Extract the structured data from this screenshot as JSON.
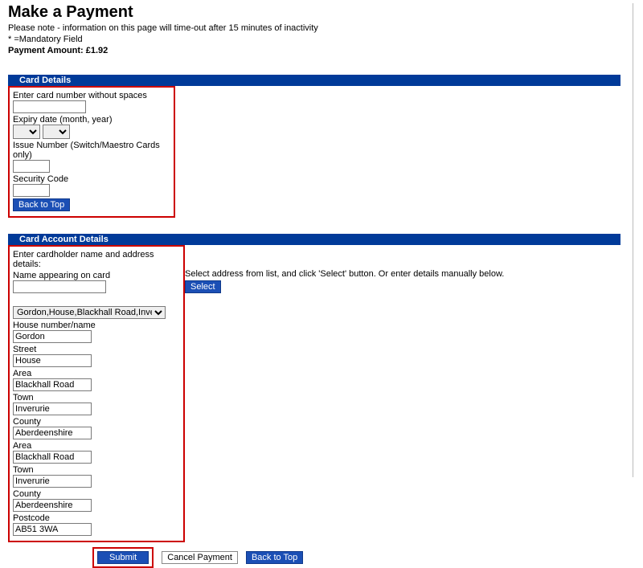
{
  "header": {
    "title": "Make a Payment",
    "note": "Please note - information on this page will time-out after 15 minutes of inactivity",
    "mandatory_hint": "* =Mandatory Field",
    "amount_label": "Payment Amount: £1.92"
  },
  "card_details": {
    "section_title": "Card Details",
    "card_number_label": "Enter card number without spaces",
    "card_number_value": "",
    "expiry_label": "Expiry date (month, year)",
    "expiry_month": "",
    "expiry_year": "",
    "issue_label": "Issue Number (Switch/Maestro Cards only)",
    "issue_value": "",
    "security_label": "Security Code",
    "security_value": "",
    "back_to_top": "Back to Top"
  },
  "account_details": {
    "section_title": "Card Account Details",
    "intro": "Enter cardholder name and address details:",
    "name_label": "Name appearing on card",
    "name_value": "",
    "address_prompt": "Select address from list, and click 'Select' button. Or enter details manually below.",
    "address_option": "Gordon,House,Blackhall Road,Inverurie,A",
    "select_btn": "Select",
    "fields": {
      "house_label": "House number/name",
      "house_value": "Gordon",
      "street_label": "Street",
      "street_value": "House",
      "area1_label": "Area",
      "area1_value": "Blackhall Road",
      "town1_label": "Town",
      "town1_value": "Inverurie",
      "county1_label": "County",
      "county1_value": "Aberdeenshire",
      "area2_label": "Area",
      "area2_value": "Blackhall Road",
      "town2_label": "Town",
      "town2_value": "Inverurie",
      "county2_label": "County",
      "county2_value": "Aberdeenshire",
      "postcode_label": "Postcode",
      "postcode_value": "AB51 3WA"
    }
  },
  "actions": {
    "submit": "Submit",
    "cancel": "Cancel Payment",
    "back_to_top": "Back to Top"
  }
}
